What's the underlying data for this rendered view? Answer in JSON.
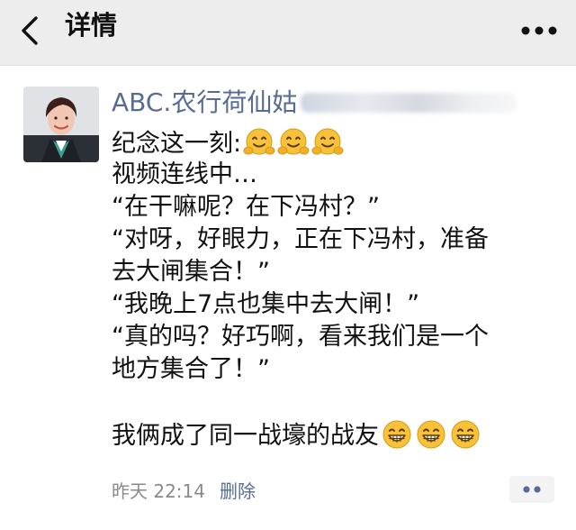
{
  "header": {
    "title": "详情",
    "back_icon": "chevron-left-icon",
    "more_icon": "more-dots-icon",
    "background": "#ededed"
  },
  "post": {
    "author": "ABC.农行荷仙姑",
    "author_color": "#576b95",
    "lines": [
      {
        "text": "纪念这一刻:",
        "emoji": "hugging-face-emoji",
        "emoji_count": 3
      },
      {
        "text": "视频连线中…"
      },
      {
        "text": "“在干嘛呢？在下冯村？”"
      },
      {
        "text": "“对呀，好眼力，正在下冯村，准备"
      },
      {
        "text": "去大闸集合！”"
      },
      {
        "text": "“我晚上7点也集中去大闸！”"
      },
      {
        "text": "“真的吗？好巧啊，看来我们是一个"
      },
      {
        "text": "地方集合了！”"
      },
      {
        "text": ""
      },
      {
        "text": "我俩成了同一战壕的战友",
        "emoji": "grinning-face-emoji",
        "emoji_count": 3
      }
    ],
    "time": "昨天 22:14",
    "delete_label": "删除",
    "comment_icon": "comment-dots-icon"
  }
}
